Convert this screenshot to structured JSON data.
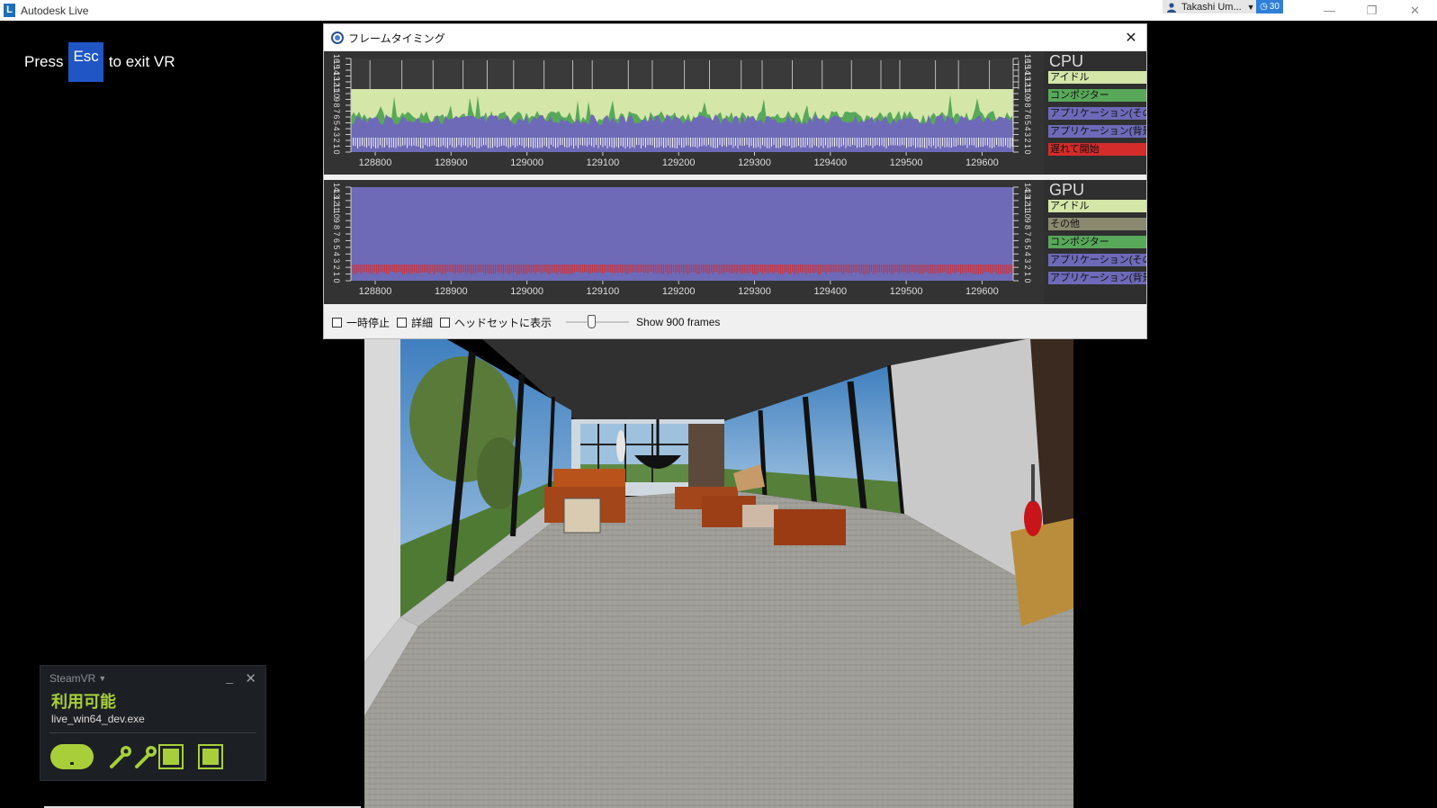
{
  "app": {
    "title": "Autodesk Live",
    "logo_letter": "L",
    "user_name": "Takashi Um...",
    "notification_count": "30",
    "controls": {
      "minimize": "—",
      "restore": "❐",
      "close": "✕"
    }
  },
  "exit_vr": {
    "prefix": "Press",
    "key": "Esc",
    "suffix": "to exit VR"
  },
  "frame_timing": {
    "title": "フレームタイミング",
    "close": "✕",
    "cpu": {
      "label": "CPU",
      "y_ticks": [
        "16",
        "15",
        "14",
        "13",
        "12",
        "11",
        "10",
        "9",
        "8",
        "7",
        "6",
        "5",
        "4",
        "3",
        "2",
        "1",
        "0"
      ],
      "x_ticks": [
        "128800",
        "128900",
        "129000",
        "129100",
        "129200",
        "129300",
        "129400",
        "129500",
        "129600"
      ],
      "legend": [
        {
          "label": "アイドル",
          "color": "#d4e6a8"
        },
        {
          "label": "コンポジター",
          "color": "#58a85a"
        },
        {
          "label": "アプリケーション(その他)",
          "color": "#6e6ab8"
        },
        {
          "label": "アプリケーション(背景)",
          "color": "#6e6ab8"
        },
        {
          "label": "遅れて開始",
          "color": "#d42b2b"
        }
      ]
    },
    "gpu": {
      "label": "GPU",
      "y_ticks": [
        "14",
        "13",
        "12",
        "11",
        "10",
        "9",
        "8",
        "7",
        "6",
        "5",
        "4",
        "3",
        "2",
        "1",
        "0"
      ],
      "x_ticks": [
        "128800",
        "128900",
        "129000",
        "129100",
        "129200",
        "129300",
        "129400",
        "129500",
        "129600"
      ],
      "legend": [
        {
          "label": "アイドル",
          "color": "#d4e6a8"
        },
        {
          "label": "その他",
          "color": "#8a8a70"
        },
        {
          "label": "コンポジター",
          "color": "#58a85a"
        },
        {
          "label": "アプリケーション(その他)",
          "color": "#6e6ab8"
        },
        {
          "label": "アプリケーション(背景)",
          "color": "#6e6ab8"
        }
      ]
    },
    "controls": {
      "pause": "一時停止",
      "detail": "詳細",
      "show_in_headset": "ヘッドセットに表示",
      "frames": "Show 900 frames",
      "slider_fraction": 0.4
    }
  },
  "steamvr": {
    "title": "SteamVR",
    "status": "利用可能",
    "app": "live_win64_dev.exe"
  }
}
